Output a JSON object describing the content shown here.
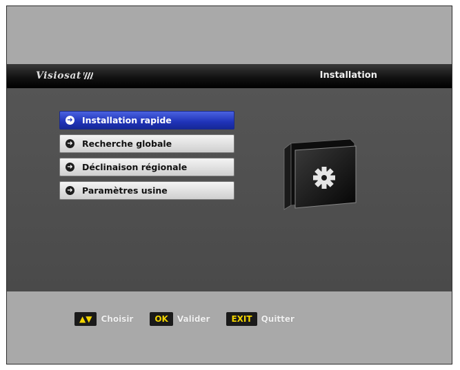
{
  "header": {
    "brand": "Visiosat",
    "title": "Installation"
  },
  "menu": {
    "items": [
      {
        "label": "Installation rapide",
        "selected": true
      },
      {
        "label": "Recherche globale",
        "selected": false
      },
      {
        "label": "Déclinaison régionale",
        "selected": false
      },
      {
        "label": "Paramètres usine",
        "selected": false
      }
    ]
  },
  "footer": {
    "hints": [
      {
        "key": "▲▼",
        "label": "Choisir"
      },
      {
        "key": "OK",
        "label": "Valider"
      },
      {
        "key": "EXIT",
        "label": "Quitter"
      }
    ]
  },
  "colors": {
    "accent": "#1f33b8",
    "key_text": "#f2d400",
    "panel": "#4d4d4d",
    "frame": "#a9a9a9"
  }
}
